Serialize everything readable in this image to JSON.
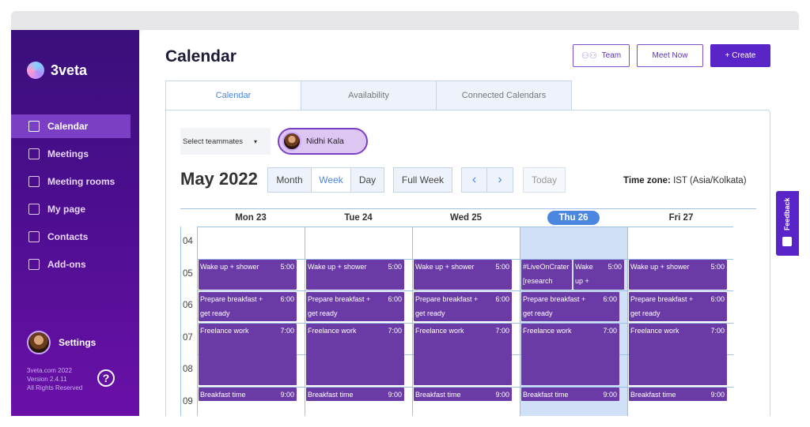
{
  "app": {
    "brand": "3veta",
    "settings_label": "Settings",
    "footer": [
      "3veta.com 2022",
      "Version 2.4.11",
      "All Rights Reserved"
    ],
    "help_symbol": "?"
  },
  "sidebar": {
    "items": [
      {
        "label": "Calendar",
        "icon": "calendar-icon",
        "active": true
      },
      {
        "label": "Meetings",
        "icon": "meetings-icon",
        "active": false
      },
      {
        "label": "Meeting rooms",
        "icon": "door-icon",
        "active": false
      },
      {
        "label": "My page",
        "icon": "monitor-icon",
        "active": false
      },
      {
        "label": "Contacts",
        "icon": "contact-icon",
        "active": false
      },
      {
        "label": "Add-ons",
        "icon": "plus-square-icon",
        "active": false
      }
    ]
  },
  "header": {
    "title": "Calendar",
    "team_label": "Team",
    "meet_now_label": "Meet Now",
    "create_label": "+ Create"
  },
  "tabs": [
    {
      "label": "Calendar",
      "active": true
    },
    {
      "label": "Availability",
      "active": false
    },
    {
      "label": "Connected Calendars",
      "active": false
    }
  ],
  "filters": {
    "teammates_label": "Select teammates",
    "selected_teammate": "Nidhi Kala"
  },
  "toolbar": {
    "month_title": "May 2022",
    "views": [
      {
        "label": "Month",
        "active": false
      },
      {
        "label": "Week",
        "active": true
      },
      {
        "label": "Day",
        "active": false
      }
    ],
    "full_week_label": "Full Week",
    "prev_symbol": "‹",
    "next_symbol": "›",
    "today_label": "Today",
    "timezone_label": "Time zone:",
    "timezone_value": "IST (Asia/Kolkata)"
  },
  "calendar": {
    "days": [
      {
        "label": "Mon 23",
        "today": false
      },
      {
        "label": "Tue 24",
        "today": false
      },
      {
        "label": "Wed 25",
        "today": false
      },
      {
        "label": "Thu 26",
        "today": true
      },
      {
        "label": "Fri 27",
        "today": false
      }
    ],
    "hours": [
      "04",
      "05",
      "06",
      "07",
      "08",
      "09"
    ],
    "events": [
      {
        "day": 0,
        "name": "Wake up + shower",
        "time": "5:00",
        "start": 5,
        "end": 6
      },
      {
        "day": 1,
        "name": "Wake up + shower",
        "time": "5:00",
        "start": 5,
        "end": 6
      },
      {
        "day": 2,
        "name": "Wake up + shower",
        "time": "5:00",
        "start": 5,
        "end": 6
      },
      {
        "day": 3,
        "name": "#LiveOnCrater [research well fo",
        "time": "",
        "start": 5,
        "end": 6,
        "half": "left"
      },
      {
        "day": 3,
        "name": "Wake up + shower",
        "time": "5:00",
        "start": 5,
        "end": 6,
        "half": "right"
      },
      {
        "day": 4,
        "name": "Wake up + shower",
        "time": "5:00",
        "start": 5,
        "end": 6
      },
      {
        "day": 0,
        "name": "Prepare breakfast + get ready",
        "time": "6:00",
        "start": 6,
        "end": 7
      },
      {
        "day": 1,
        "name": "Prepare breakfast + get ready",
        "time": "6:00",
        "start": 6,
        "end": 7
      },
      {
        "day": 2,
        "name": "Prepare breakfast + get ready",
        "time": "6:00",
        "start": 6,
        "end": 7
      },
      {
        "day": 3,
        "name": "Prepare breakfast + get ready",
        "time": "6:00",
        "start": 6,
        "end": 7
      },
      {
        "day": 4,
        "name": "Prepare breakfast + get ready",
        "time": "6:00",
        "start": 6,
        "end": 7
      },
      {
        "day": 0,
        "name": "Freelance work",
        "time": "7:00",
        "start": 7,
        "end": 9
      },
      {
        "day": 1,
        "name": "Freelance work",
        "time": "7:00",
        "start": 7,
        "end": 9
      },
      {
        "day": 2,
        "name": "Freelance work",
        "time": "7:00",
        "start": 7,
        "end": 9
      },
      {
        "day": 3,
        "name": "Freelance work",
        "time": "7:00",
        "start": 7,
        "end": 9
      },
      {
        "day": 4,
        "name": "Freelance work",
        "time": "7:00",
        "start": 7,
        "end": 9
      },
      {
        "day": 0,
        "name": "Breakfast time",
        "time": "9:00",
        "start": 9,
        "end": 9.5
      },
      {
        "day": 1,
        "name": "Breakfast time",
        "time": "9:00",
        "start": 9,
        "end": 9.5
      },
      {
        "day": 2,
        "name": "Breakfast time",
        "time": "9:00",
        "start": 9,
        "end": 9.5
      },
      {
        "day": 3,
        "name": "Breakfast time",
        "time": "9:00",
        "start": 9,
        "end": 9.5
      },
      {
        "day": 4,
        "name": "Breakfast time",
        "time": "9:00",
        "start": 9,
        "end": 9.5
      }
    ]
  },
  "feedback_label": "Feedback",
  "colors": {
    "sidebar": "#4c0e8f",
    "accent": "#5a25c8",
    "event": "#6a3aa6",
    "link": "#4b86e0"
  }
}
